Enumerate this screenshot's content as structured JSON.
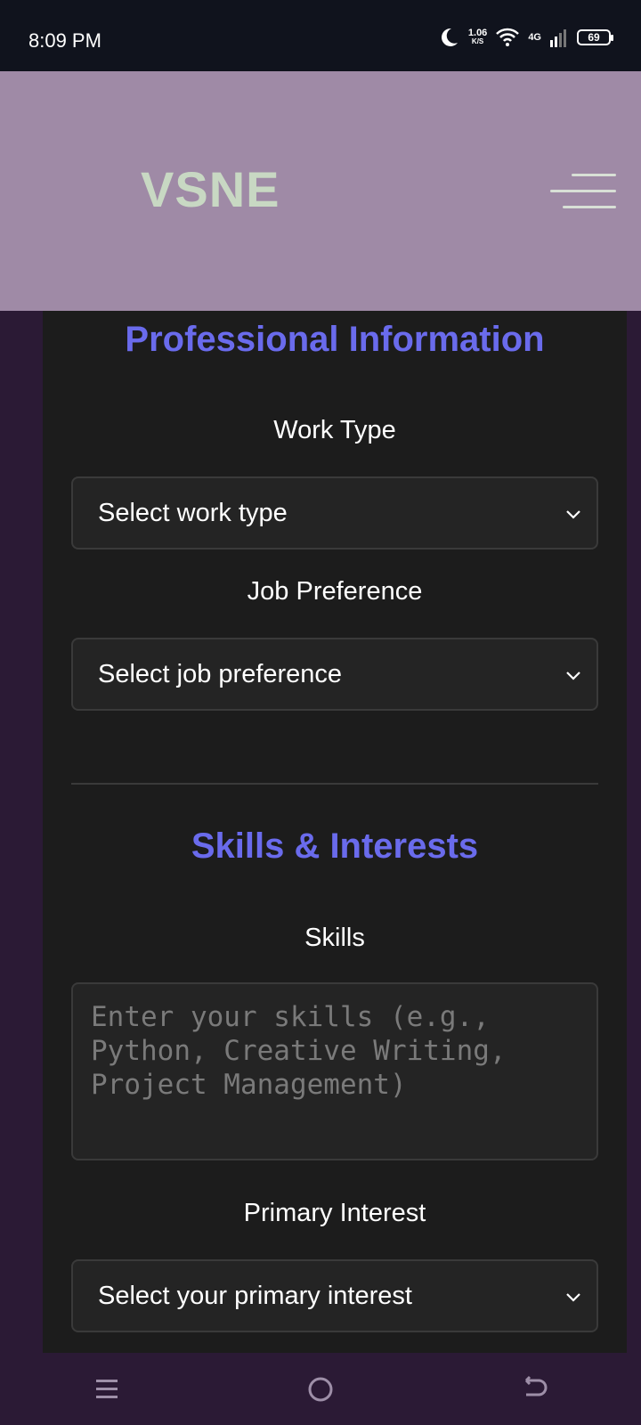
{
  "status_bar": {
    "time": "8:09 PM",
    "net_speed": "1.06",
    "net_speed_unit": "K/S",
    "network": "4G",
    "battery": "69",
    "icons": [
      "moon-icon",
      "wifi-icon",
      "signal-icon",
      "battery-icon"
    ]
  },
  "header": {
    "logo": "VSNE",
    "menu_icon": "hamburger-menu-icon"
  },
  "professional": {
    "title": "Professional Information",
    "work_type": {
      "label": "Work Type",
      "value": "Select work type"
    },
    "job_preference": {
      "label": "Job Preference",
      "value": "Select job preference"
    }
  },
  "skills": {
    "title": "Skills & Interests",
    "skills_field": {
      "label": "Skills",
      "placeholder": "Enter your skills (e.g., Python, Creative Writing, Project Management)"
    },
    "primary_interest": {
      "label": "Primary Interest",
      "value": "Select your primary interest"
    }
  },
  "colors": {
    "section_title": "#6a6bec",
    "header_bg": "#9f8aa6",
    "logo": "#c8d8c3",
    "card_bg": "#1c1c1c",
    "page_bg": "#2b1a35"
  }
}
